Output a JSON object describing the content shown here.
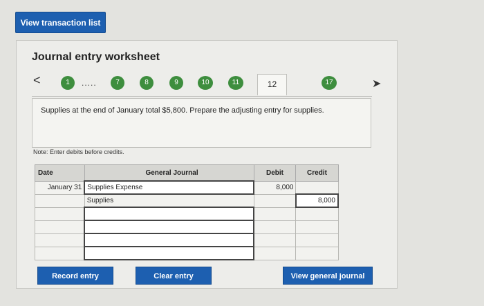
{
  "top_button": "View transaction list",
  "worksheet_title": "Journal entry worksheet",
  "nav": {
    "prev_glyph": "<",
    "next_glyph": "➤",
    "dots": ".....",
    "steps": [
      "1",
      "7",
      "8",
      "9",
      "10",
      "11",
      "12",
      "17"
    ],
    "current": "12"
  },
  "prompt": "Supplies at the end of January total $5,800. Prepare the adjusting entry for supplies.",
  "note": "Note: Enter debits before credits.",
  "table": {
    "headers": {
      "date": "Date",
      "journal": "General Journal",
      "debit": "Debit",
      "credit": "Credit"
    },
    "rows": [
      {
        "date": "January 31",
        "account": "Supplies Expense",
        "debit": "8,000",
        "credit": ""
      },
      {
        "date": "",
        "account": "Supplies",
        "debit": "",
        "credit": "8,000"
      },
      {
        "date": "",
        "account": "",
        "debit": "",
        "credit": ""
      },
      {
        "date": "",
        "account": "",
        "debit": "",
        "credit": ""
      },
      {
        "date": "",
        "account": "",
        "debit": "",
        "credit": ""
      },
      {
        "date": "",
        "account": "",
        "debit": "",
        "credit": ""
      }
    ]
  },
  "buttons": {
    "record": "Record entry",
    "clear": "Clear entry",
    "view_journal": "View general journal"
  },
  "colors": {
    "accent": "#1d5fb0",
    "step": "#3e8e3e"
  }
}
